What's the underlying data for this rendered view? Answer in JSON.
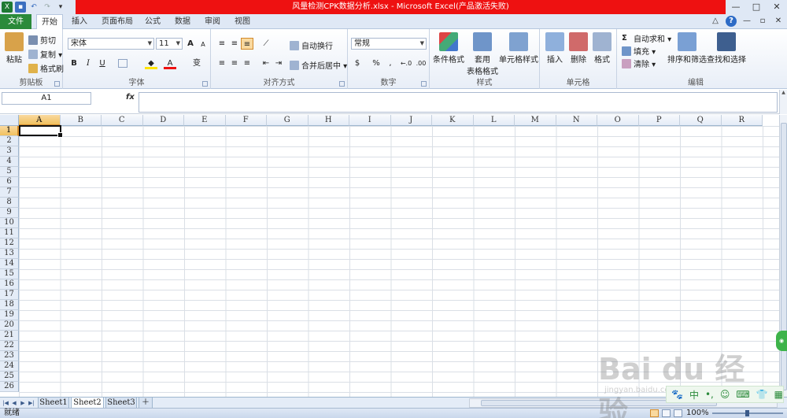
{
  "window": {
    "title": "风量检测CPK数据分析.xlsx  -  Microsoft Excel(产品激活失败)",
    "controls": [
      "—",
      "□",
      "✕"
    ]
  },
  "tabs": {
    "file": "文件",
    "items": [
      "开始",
      "插入",
      "页面布局",
      "公式",
      "数据",
      "审阅",
      "视图"
    ],
    "active": "开始"
  },
  "ribbon": {
    "clipboard": {
      "label": "剪贴板",
      "paste": "粘贴",
      "cut": "剪切",
      "copy": "复制 ▾",
      "format_painter": "格式刷"
    },
    "font": {
      "label": "字体",
      "name": "宋体",
      "size": "11",
      "bold": "B",
      "italic": "I",
      "underline": "U",
      "grow": "A",
      "shrink": "A",
      "phonetic": "变"
    },
    "alignment": {
      "label": "对齐方式",
      "wrap": "自动换行",
      "merge": "合并后居中 ▾"
    },
    "number": {
      "label": "数字",
      "format": "常规",
      "percent": "%",
      "comma": ",",
      "inc_decimal": "←.0",
      "dec_decimal": ".00"
    },
    "styles": {
      "label": "样式",
      "conditional": "条件格式",
      "table_1": "套用",
      "table_2": "表格格式",
      "cell_styles": "单元格样式"
    },
    "cells": {
      "label": "单元格",
      "insert": "插入",
      "delete": "删除",
      "format": "格式"
    },
    "editing": {
      "label": "编辑",
      "autosum": "自动求和 ▾",
      "fill": "填充 ▾",
      "clear": "清除 ▾",
      "sort": "排序和筛选",
      "find": "查找和选择"
    }
  },
  "formula_bar": {
    "name_box": "A1",
    "fx": "fx",
    "value": ""
  },
  "grid": {
    "columns": [
      "A",
      "B",
      "C",
      "D",
      "E",
      "F",
      "G",
      "H",
      "I",
      "J",
      "K",
      "L",
      "M",
      "N",
      "O",
      "P",
      "Q",
      "R"
    ],
    "rows": [
      "1",
      "2",
      "3",
      "4",
      "5",
      "6",
      "7",
      "8",
      "9",
      "10",
      "11",
      "12",
      "13",
      "14",
      "15",
      "16",
      "17",
      "18",
      "19",
      "20",
      "21",
      "22",
      "23",
      "24",
      "25",
      "26"
    ],
    "active_cell": "A1"
  },
  "sheets": {
    "items": [
      "Sheet1",
      "Sheet2",
      "Sheet3"
    ],
    "active": "Sheet2"
  },
  "status": {
    "text": "就绪",
    "zoom": "100%"
  },
  "watermark": {
    "main": "Bai du 经验",
    "sub": "jingyan.baidu.com"
  },
  "colors": {
    "title_red": "#ee1111",
    "file_tab": "#2a8a3a",
    "selection": "#f1c15f"
  }
}
